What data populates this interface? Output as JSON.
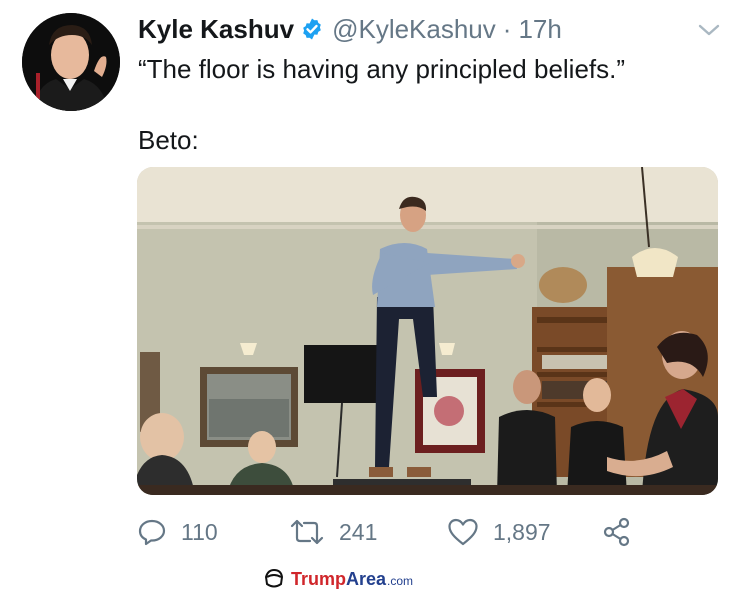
{
  "tweet": {
    "display_name": "Kyle Kashuv",
    "handle": "@KyleKashuv",
    "separator": "·",
    "time": "17h",
    "line1": "“The floor is having any principled beliefs.”",
    "line2": "Beto:",
    "verified_icon": "verified-badge-icon",
    "menu_icon": "chevron-down-icon"
  },
  "actions": {
    "reply_count": "110",
    "retweet_count": "241",
    "like_count": "1,897",
    "reply_icon": "reply-icon",
    "retweet_icon": "retweet-icon",
    "like_icon": "heart-icon",
    "share_icon": "share-icon"
  },
  "watermark": {
    "part1": "Trump",
    "part2": "Area",
    "part3": ".com"
  },
  "colors": {
    "verified": "#1da1f2",
    "muted": "#657786",
    "text": "#14171a",
    "watermark_red": "#d0262b",
    "watermark_blue": "#23408e"
  }
}
